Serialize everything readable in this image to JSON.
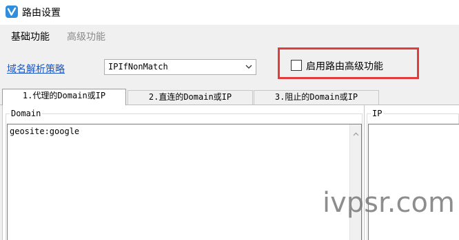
{
  "window": {
    "title": "路由设置"
  },
  "menu": {
    "basic": "基础功能",
    "advanced": "高级功能"
  },
  "policy": {
    "label": "域名解析策略",
    "selected": "IPIfNonMatch"
  },
  "advanced_toggle": {
    "label": "启用路由高级功能",
    "checked": false
  },
  "tabs": [
    {
      "label": "1.代理的Domain或IP"
    },
    {
      "label": "2.直连的Domain或IP"
    },
    {
      "label": "3.阻止的Domain或IP"
    }
  ],
  "domain_group": {
    "label": "Domain",
    "value": "geosite:google"
  },
  "ip_group": {
    "label": "IP",
    "value": ""
  },
  "watermark": "ivpsr.com",
  "colors": {
    "highlight": "#e23b3b",
    "link": "#1a56c4",
    "icon_bg": "#2f8fdc"
  }
}
